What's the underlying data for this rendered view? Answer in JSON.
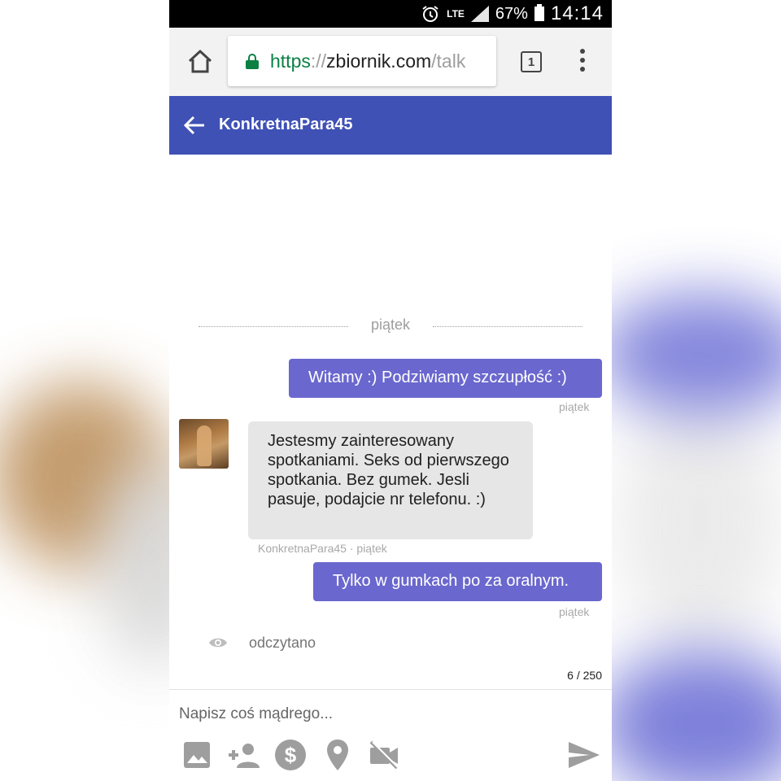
{
  "status_bar": {
    "lte": "LTE",
    "battery": "67%",
    "time": "14:14"
  },
  "browser": {
    "url_scheme": "https",
    "url_sep": "://",
    "url_domain": "zbiornik.com",
    "url_path": "/talk",
    "tab_count": "1"
  },
  "header": {
    "title": "KonkretnaPara45"
  },
  "chat": {
    "day_divider": "piątek",
    "messages": [
      {
        "direction": "out",
        "text": "Witamy :) Podziwiamy szczupłość :)",
        "meta": "piątek"
      },
      {
        "direction": "in",
        "text": "Jestesmy zainteresowany spotkaniami. Seks od pierwszego spotkania. Bez gumek. Jesli pasuje, podajcie nr telefonu. :)",
        "meta": "KonkretnaPara45 · piątek"
      },
      {
        "direction": "out",
        "text": "Tylko w gumkach po za oralnym.",
        "meta": "piątek"
      }
    ],
    "read_status": "odczytano"
  },
  "composer": {
    "counter": "6 / 250",
    "placeholder": "Napisz coś mądrego...",
    "tools": [
      "image-icon",
      "add-person-icon",
      "dollar-icon",
      "location-icon",
      "video-off-icon"
    ],
    "send_icon": "send-icon"
  },
  "colors": {
    "header": "#3f51b5",
    "bubble_out": "#6a67ce",
    "bubble_in": "#e6e6e6",
    "secure_green": "#0b8043"
  }
}
